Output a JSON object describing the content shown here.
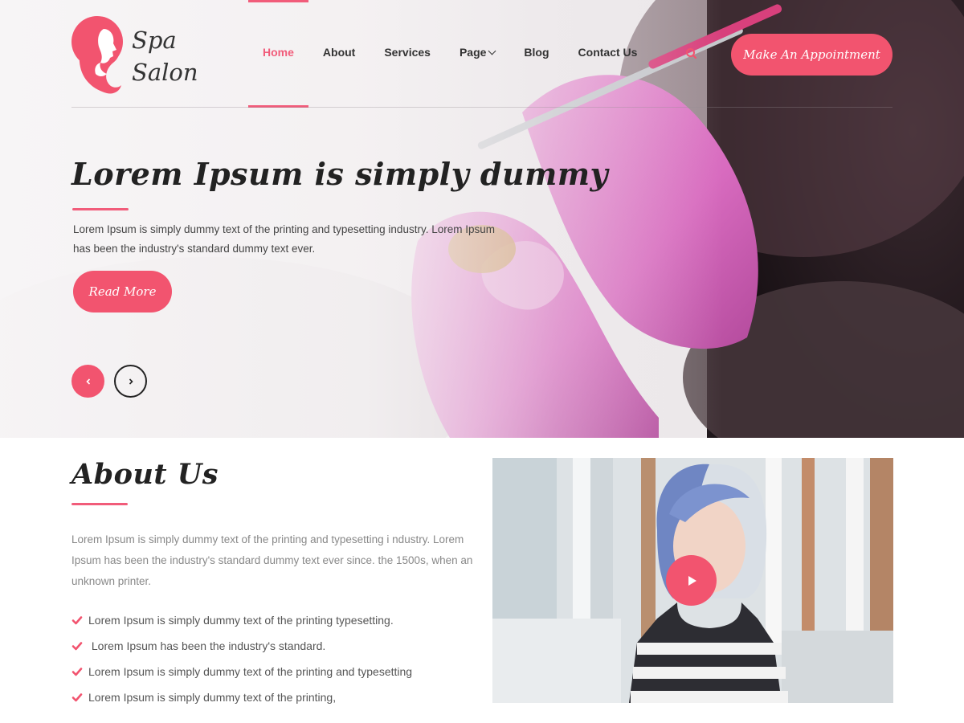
{
  "colors": {
    "accent": "#f2546f",
    "heading": "#222222",
    "body_text": "#888888"
  },
  "brand": {
    "line1": "Spa",
    "line2": "Salon"
  },
  "nav": {
    "items": [
      {
        "label": "Home",
        "active": true
      },
      {
        "label": "About"
      },
      {
        "label": "Services"
      },
      {
        "label": "Page",
        "has_dropdown": true
      },
      {
        "label": "Blog"
      },
      {
        "label": "Contact Us"
      }
    ],
    "search_icon": "search-icon"
  },
  "header": {
    "cta_label": "Make An Appointment"
  },
  "hero": {
    "title": "Lorem Ipsum is simply dummy",
    "text": "Lorem Ipsum is simply dummy text of the printing and typesetting industry. Lorem Ipsum has been the industry's standard dummy text ever.",
    "button_label": "Read More",
    "prev_icon": "chevron-left-icon",
    "next_icon": "chevron-right-icon"
  },
  "about": {
    "title": "About Us",
    "text": "Lorem Ipsum is simply dummy text of the printing and typesetting i ndustry. Lorem Ipsum has been the industry's standard dummy text ever since. the 1500s, when an unknown printer.",
    "list": [
      "Lorem Ipsum is simply dummy text of the printing typesetting.",
      " Lorem Ipsum has been the industry's standard.",
      "Lorem Ipsum is simply dummy text of the printing and typesetting",
      "Lorem Ipsum is simply dummy text of the printing,"
    ],
    "video_icon": "play-icon"
  }
}
